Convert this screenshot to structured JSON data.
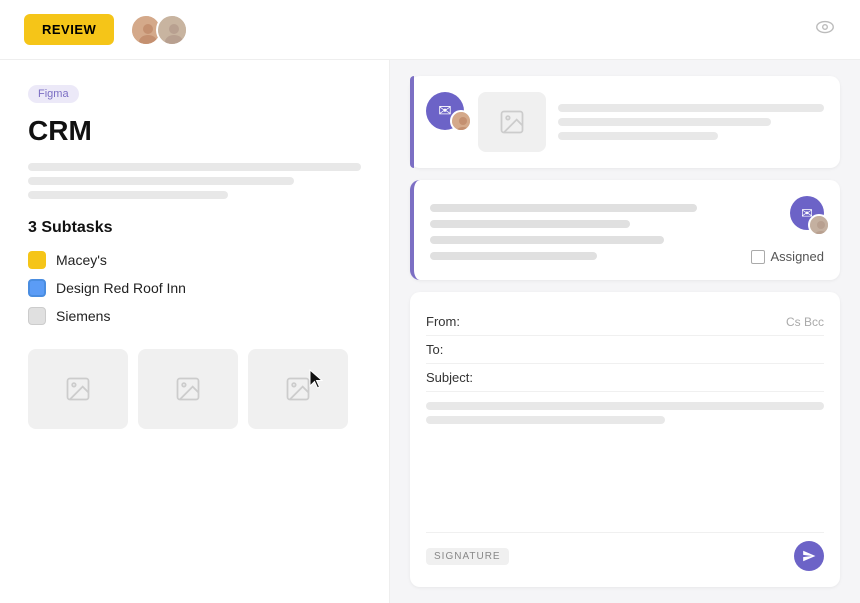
{
  "topbar": {
    "review_label": "REVIEW",
    "eye_icon": "eye-icon"
  },
  "left_panel": {
    "badge": "Figma",
    "title": "CRM",
    "subtasks_title": "3 Subtasks",
    "subtasks": [
      {
        "label": "Macey's",
        "color": "yellow"
      },
      {
        "label": "Design Red Roof Inn",
        "color": "blue"
      },
      {
        "label": "Siemens",
        "color": "gray"
      }
    ]
  },
  "right_panel": {
    "card1": {
      "assigned_label": "Assigned"
    },
    "compose": {
      "from_label": "From:",
      "to_label": "To:",
      "subject_label": "Subject:",
      "cc_label": "Cs Bcc",
      "signature_label": "SIGNATURE"
    }
  }
}
